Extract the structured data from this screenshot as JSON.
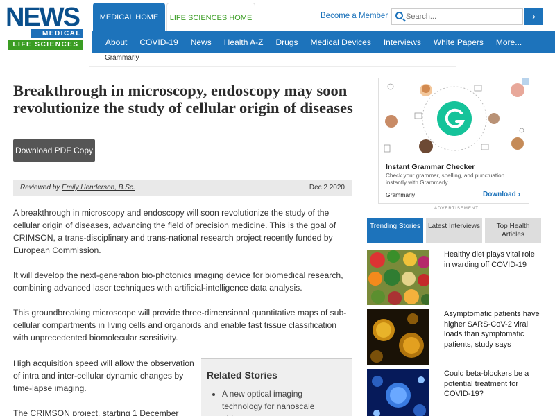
{
  "logo": {
    "news": "NEWS",
    "medical": "MEDICAL",
    "life_sciences": "LIFE SCIENCES"
  },
  "site_tabs": {
    "medical_home": "MEDICAL HOME",
    "life_sciences_home": "LIFE SCIENCES HOME"
  },
  "header": {
    "become_member": "Become a Member",
    "search_placeholder": "Search...",
    "search_button_icon": "chevron-right-icon"
  },
  "nav": [
    "About",
    "COVID-19",
    "News",
    "Health A-Z",
    "Drugs",
    "Medical Devices",
    "Interviews",
    "White Papers",
    "More..."
  ],
  "top_ad": {
    "label": "Grammarly"
  },
  "article": {
    "title": "Breakthrough in microscopy, endoscopy may soon revolutionize the study of cellular origin of diseases",
    "download_label": "Download PDF Copy",
    "reviewed_prefix": "Reviewed by",
    "reviewer": "Emily Henderson, B.Sc.",
    "date": "Dec 2 2020",
    "paragraphs": [
      "A breakthrough in microscopy and endoscopy will soon revolutionize the study of the cellular origin of diseases, advancing the field of precision medicine. This is the goal of CRIMSON, a trans-disciplinary and trans-national research project recently funded by European Commission.",
      "It will develop the next-generation bio-photonics imaging device for biomedical research, combining advanced laser techniques with artificial-intelligence data analysis.",
      "This groundbreaking microscope will provide three-dimensional quantitative maps of sub-cellular compartments in living cells and organoids and enable fast tissue classification with unprecedented biomolecular sensitivity.",
      "High acquisition speed will allow the observation of intra and inter-cellular dynamic changes by time-lapse imaging.",
      "The CRIMSON project, starting 1 December"
    ]
  },
  "related": {
    "heading": "Related Stories",
    "items": [
      "A new optical imaging technology for nanoscale objects"
    ]
  },
  "side_ad": {
    "title": "Instant Grammar Checker",
    "description": "Check your grammar, spelling, and punctuation instantly with Grammarly",
    "brand": "Grammarly",
    "download": "Download",
    "advertisement": "ADVERTISEMENT",
    "brand_color": "#15c39a"
  },
  "side_tabs": [
    "Trending Stories",
    "Latest Interviews",
    "Top Health Articles"
  ],
  "stories": [
    {
      "title": "Healthy diet plays vital role in warding off COVID-19",
      "thumb": "vegetables-image"
    },
    {
      "title": "Asymptomatic patients have higher SARS-CoV-2 viral loads than symptomatic patients, study says",
      "thumb": "virus-image"
    },
    {
      "title": "Could beta-blockers be a potential treatment for COVID-19?",
      "thumb": "coronavirus-image"
    }
  ],
  "colors": {
    "primary_blue": "#1d73bb",
    "green": "#3a9d23",
    "logo_blue": "#0a4f8c"
  }
}
